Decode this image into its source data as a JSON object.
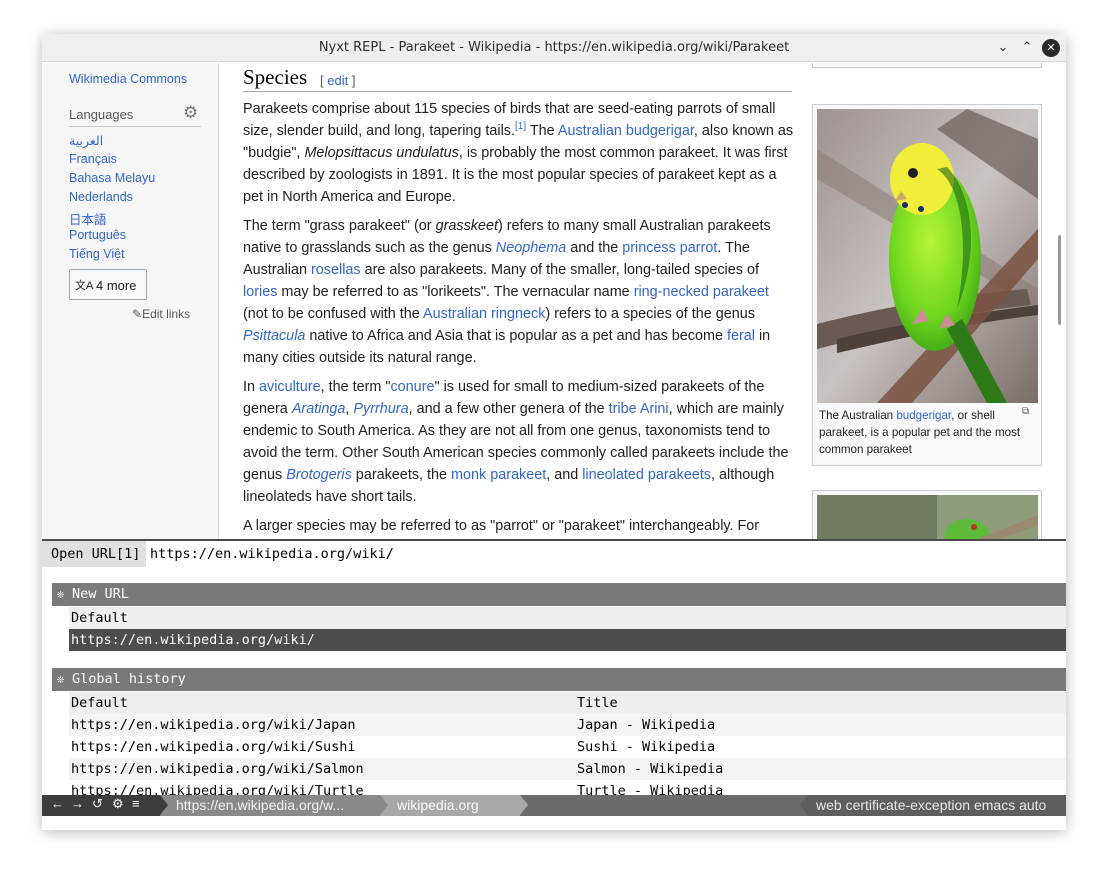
{
  "window": {
    "title": "Nyxt REPL - Parakeet - Wikipedia - https://en.wikipedia.org/wiki/Parakeet",
    "close_glyph": "✕",
    "minimize_glyph": "⌄",
    "maximize_glyph": "⌃"
  },
  "sidebar": {
    "commons": "Wikimedia Commons",
    "languages_heading": "Languages",
    "languages": [
      "العربية",
      "Français",
      "Bahasa Melayu",
      "Nederlands",
      "日本語",
      "Português",
      "Tiếng Việt"
    ],
    "more_button": "4 more",
    "edit_links": "Edit links"
  },
  "article": {
    "heading": "Species",
    "edit_open": "[ ",
    "edit_label": "edit",
    "edit_close": " ]"
  },
  "figure": {
    "caption_pre": "The Australian ",
    "caption_link": "budgerigar",
    "caption_post": ", or shell parakeet, is a popular pet and the most common parakeet"
  },
  "prompt": {
    "label": "Open URL[1]",
    "input_value": "https://en.wikipedia.org/wiki/",
    "sources": [
      {
        "name": "New URL",
        "columns": [
          "Default"
        ],
        "rows": [
          {
            "default": "https://en.wikipedia.org/wiki/",
            "title": "",
            "selected": true
          }
        ]
      },
      {
        "name": "Global history",
        "columns": [
          "Default",
          "Title"
        ],
        "rows": [
          {
            "default": "https://en.wikipedia.org/wiki/Japan",
            "title": "Japan - Wikipedia"
          },
          {
            "default": "https://en.wikipedia.org/wiki/Sushi",
            "title": "Sushi - Wikipedia"
          },
          {
            "default": "https://en.wikipedia.org/wiki/Salmon",
            "title": "Salmon - Wikipedia"
          },
          {
            "default": "https://en.wikipedia.org/wiki/Turtle",
            "title": "Turtle - Wikipedia"
          }
        ]
      }
    ]
  },
  "statusbar": {
    "nav": [
      "←",
      "→",
      "↺",
      "⚙",
      "≡"
    ],
    "url": "https://en.wikipedia.org/w...",
    "domain": "wikipedia.org",
    "modes": "web certificate-exception emacs auto"
  }
}
